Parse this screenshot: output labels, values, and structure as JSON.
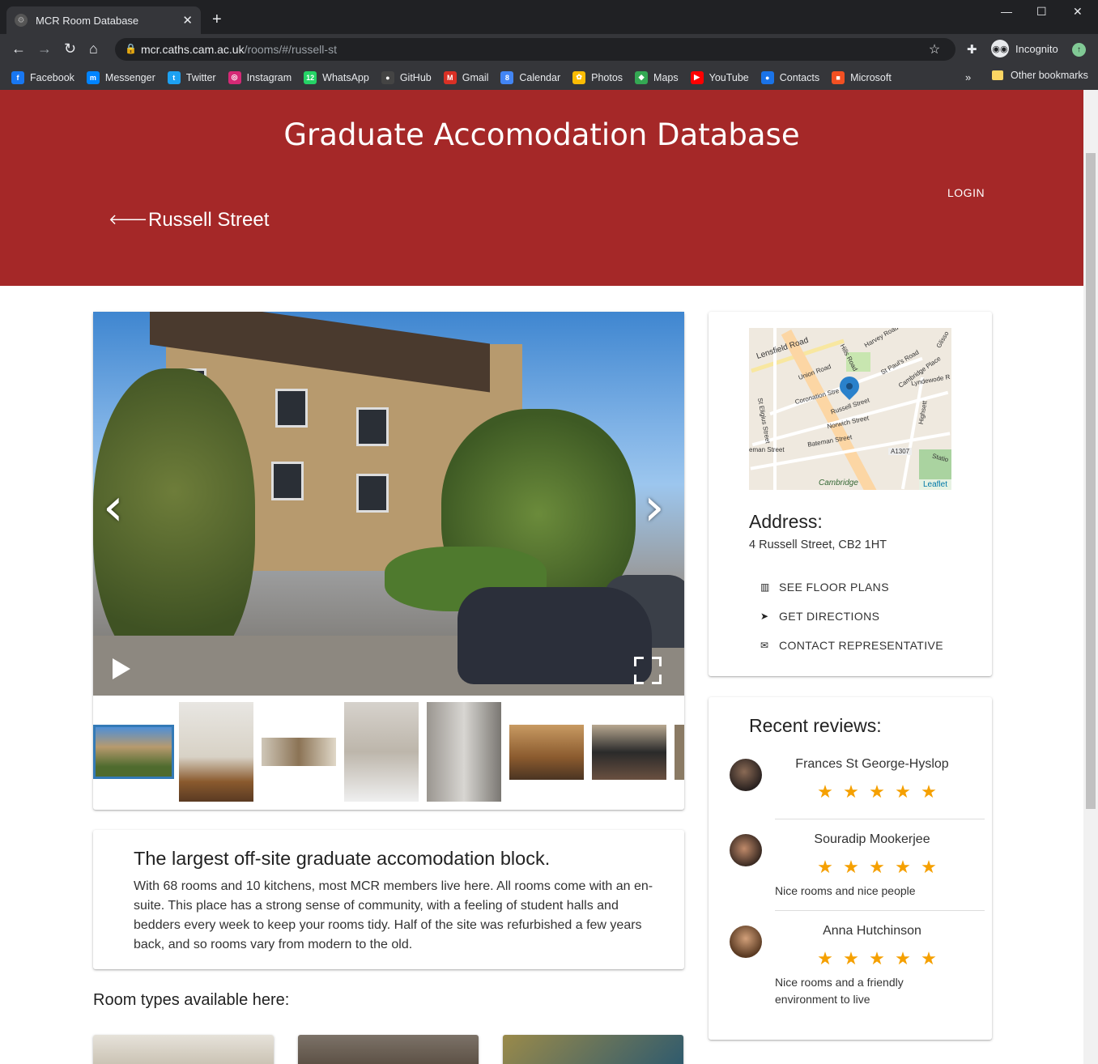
{
  "browser": {
    "tab_title": "MCR Room Database",
    "url_host": "mcr.caths.cam.ac.uk",
    "url_path": "/rooms/#/russell-st",
    "profile_label": "Incognito",
    "bookmarks": [
      {
        "label": "Facebook",
        "icon": "facebook-icon",
        "color": "#1877f2",
        "glyph": "f"
      },
      {
        "label": "Messenger",
        "icon": "messenger-icon",
        "color": "#0084ff",
        "glyph": "m"
      },
      {
        "label": "Twitter",
        "icon": "twitter-icon",
        "color": "#1da1f2",
        "glyph": "t"
      },
      {
        "label": "Instagram",
        "icon": "instagram-icon",
        "color": "#d62976",
        "glyph": "◎"
      },
      {
        "label": "WhatsApp",
        "icon": "whatsapp-icon",
        "color": "#25d366",
        "glyph": "12"
      },
      {
        "label": "GitHub",
        "icon": "github-icon",
        "color": "#444",
        "glyph": "●"
      },
      {
        "label": "Gmail",
        "icon": "gmail-icon",
        "color": "#d93025",
        "glyph": "M"
      },
      {
        "label": "Calendar",
        "icon": "calendar-icon",
        "color": "#4285f4",
        "glyph": "8"
      },
      {
        "label": "Photos",
        "icon": "photos-icon",
        "color": "#fbbc04",
        "glyph": "✿"
      },
      {
        "label": "Maps",
        "icon": "maps-icon",
        "color": "#34a853",
        "glyph": "◆"
      },
      {
        "label": "YouTube",
        "icon": "youtube-icon",
        "color": "#ff0000",
        "glyph": "▶"
      },
      {
        "label": "Contacts",
        "icon": "contacts-icon",
        "color": "#1a73e8",
        "glyph": "●"
      },
      {
        "label": "Microsoft",
        "icon": "microsoft-icon",
        "color": "#f25022",
        "glyph": "■"
      }
    ],
    "other_bookmarks": "Other bookmarks"
  },
  "header": {
    "site_title": "Graduate Accomodation Database",
    "page_title": "Russell Street",
    "login_label": "LOGIN"
  },
  "description": {
    "heading": "The largest off-site graduate accomodation block.",
    "body": "With 68 rooms and 10 kitchens, most MCR members live here. All rooms come with an en-suite. This place has a strong sense of community, with a feeling of student halls and bedders every week to keep your rooms tidy. Half of the site was refurbished a few years back, and so rooms vary from modern to the old."
  },
  "room_types_title": "Room types available here:",
  "location": {
    "address_label": "Address:",
    "address": "4 Russell Street, CB2 1HT",
    "map_attribution": "Leaflet",
    "map_labels": [
      "Lensfield Road",
      "Hills Road",
      "Harvey Road",
      "St Paul's Road",
      "Union Road",
      "Cambridge Place",
      "Lyndewode R",
      "Coronation Stre",
      "Russell Street",
      "Norwich Street",
      "Bateman Street",
      "A1307",
      "Highsett",
      "Cambridge",
      "Statio",
      "St Eligius Street",
      "eman Street",
      "Glisso"
    ],
    "actions": [
      {
        "label": "SEE FLOOR PLANS",
        "icon": "map-icon"
      },
      {
        "label": "GET DIRECTIONS",
        "icon": "location-arrow-icon"
      },
      {
        "label": "CONTACT REPRESENTATIVE",
        "icon": "envelope-icon"
      }
    ]
  },
  "reviews": {
    "title": "Recent reviews:",
    "items": [
      {
        "name": "Frances St George-Hyslop",
        "rating": 5,
        "text": ""
      },
      {
        "name": "Souradip Mookerjee",
        "rating": 5,
        "text": "Nice rooms and nice people"
      },
      {
        "name": "Anna Hutchinson",
        "rating": 5,
        "text": "Nice rooms and a friendly environment to live"
      }
    ]
  },
  "colors": {
    "brand_red": "#a52828",
    "star": "#f5a000"
  }
}
